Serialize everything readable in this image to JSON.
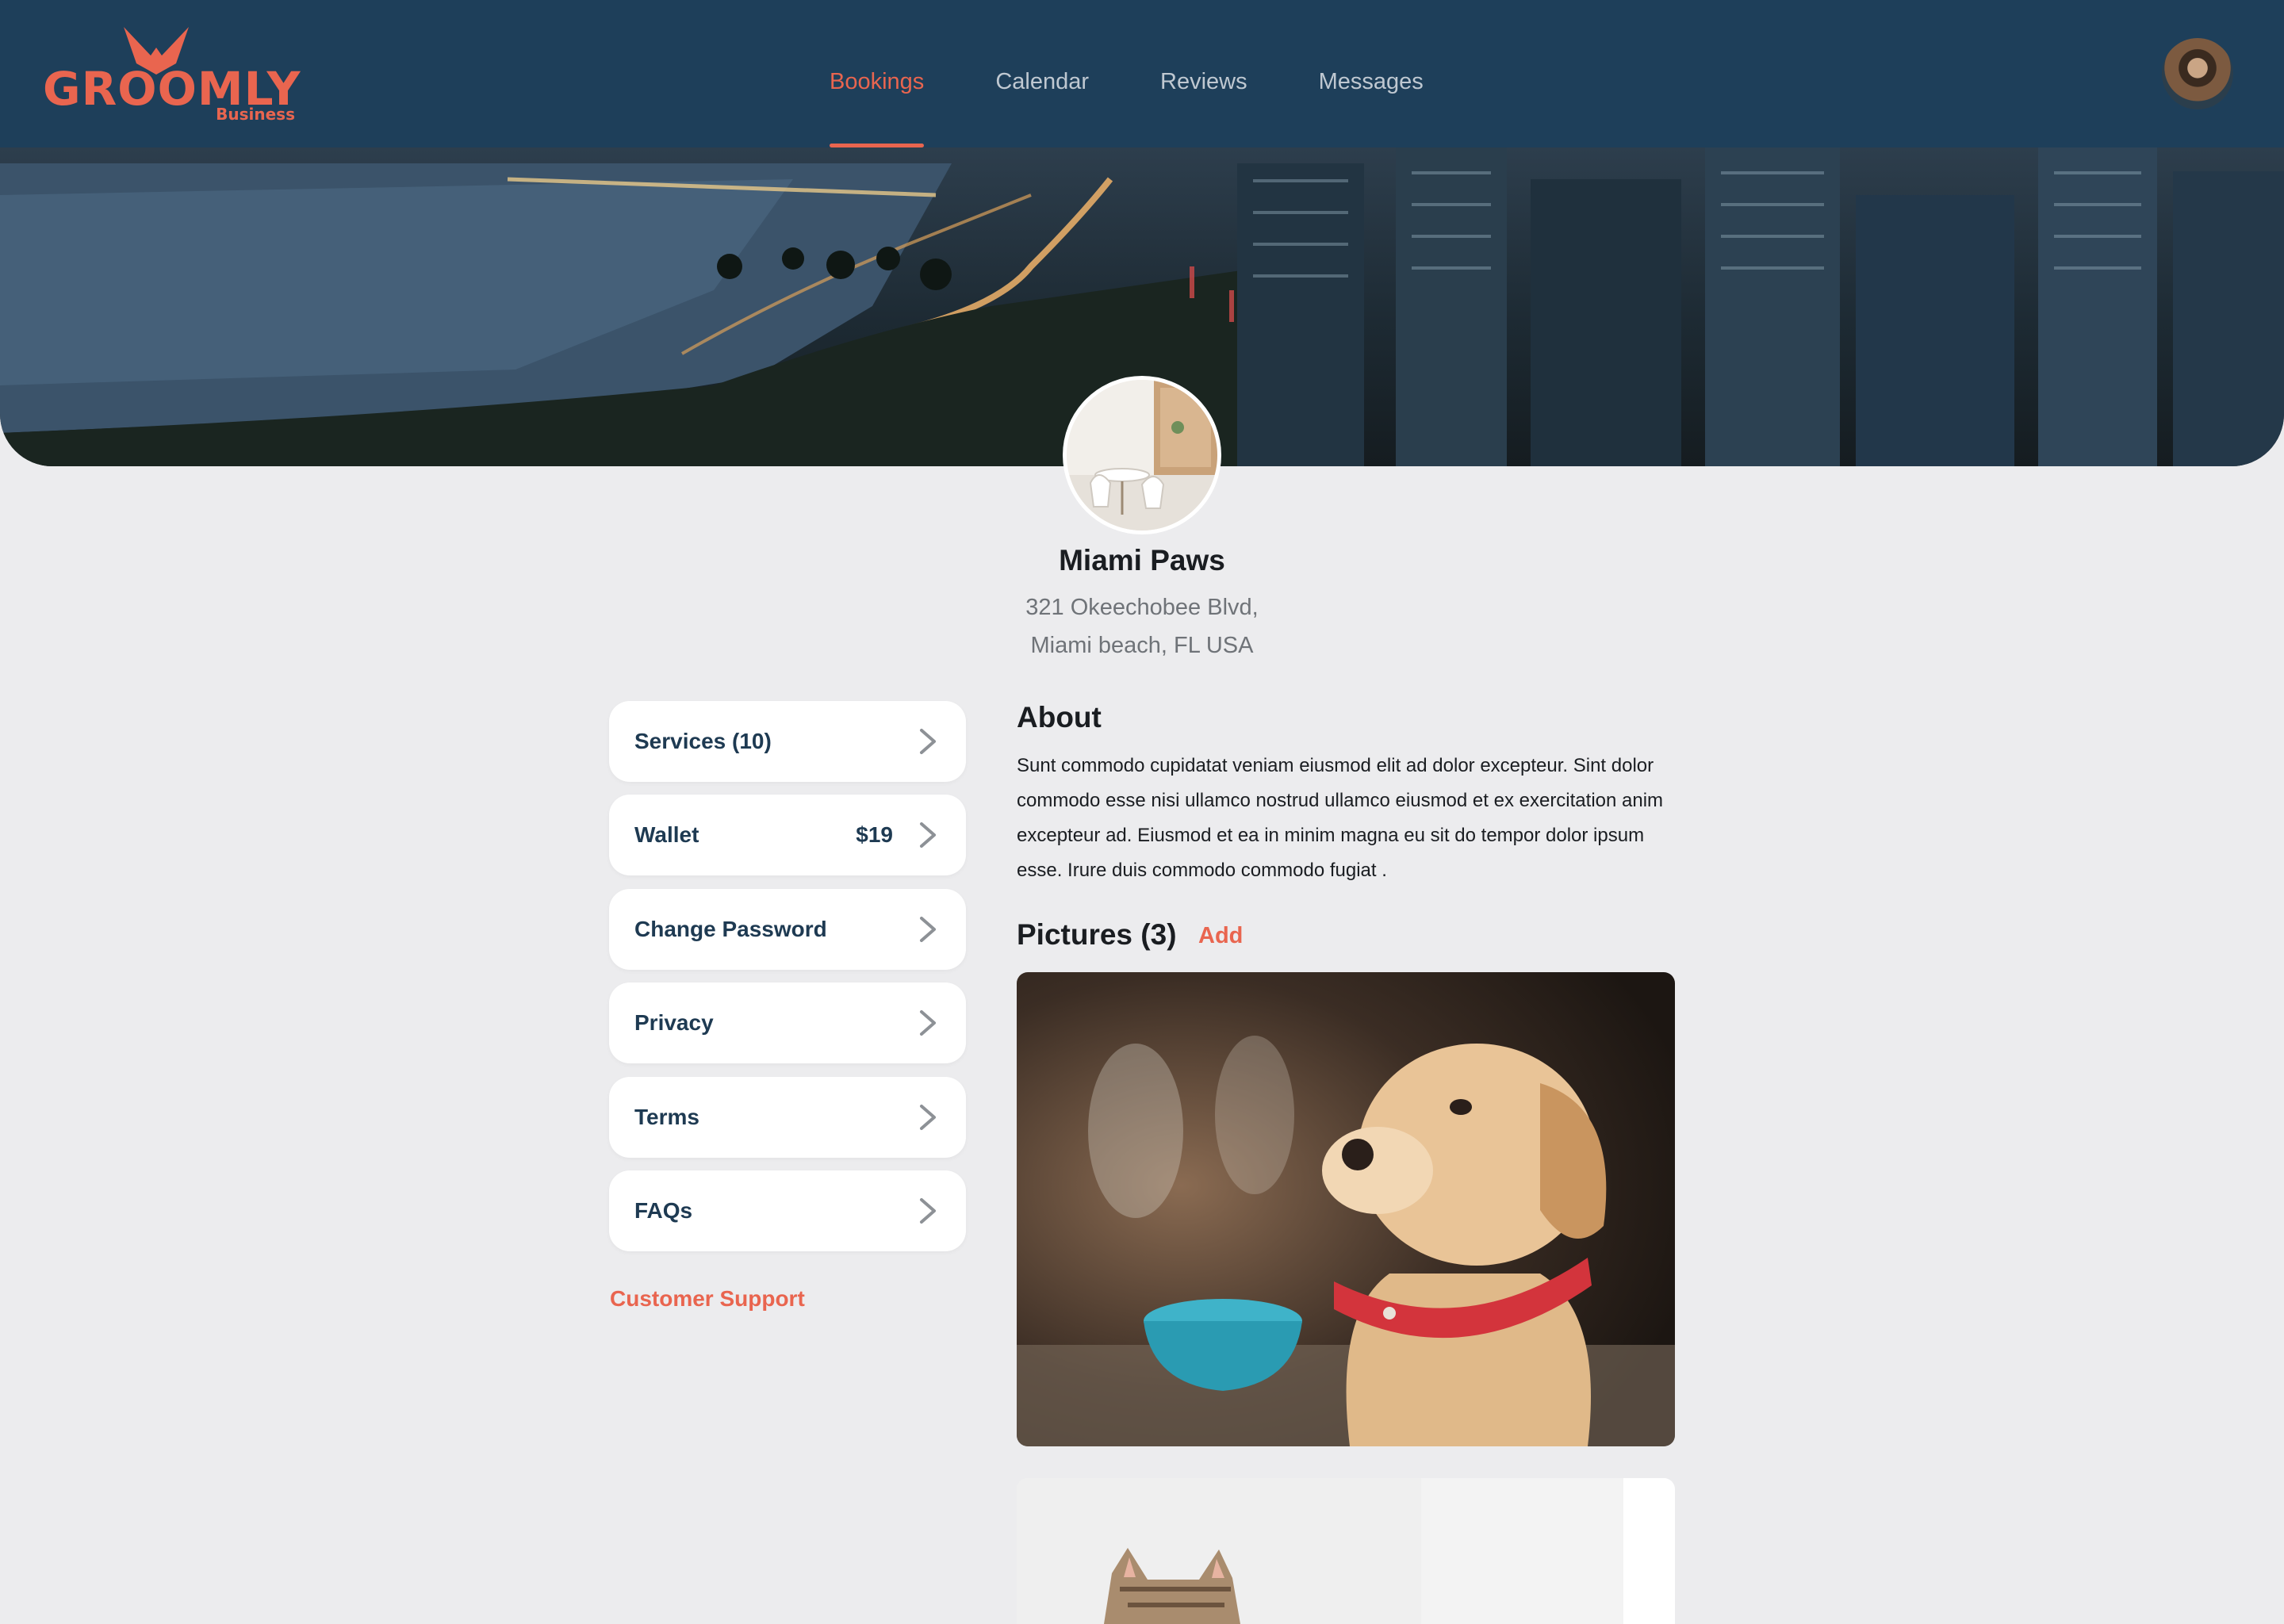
{
  "brand": {
    "name": "GROOMLY",
    "sub": "Business",
    "color": "#e9654f",
    "header_bg": "#1e3f5a"
  },
  "nav": {
    "items": [
      {
        "label": "Bookings",
        "active": true
      },
      {
        "label": "Calendar",
        "active": false
      },
      {
        "label": "Reviews",
        "active": false
      },
      {
        "label": "Messages",
        "active": false
      }
    ]
  },
  "user": {
    "avatar_icon": "user-avatar"
  },
  "business": {
    "name": "Miami Paws",
    "address_line1": "321 Okeechobee Blvd,",
    "address_line2": "Miami beach, FL USA"
  },
  "menu": {
    "items": [
      {
        "label": "Services (10)",
        "value": ""
      },
      {
        "label": "Wallet",
        "value": "$19"
      },
      {
        "label": "Change Password",
        "value": ""
      },
      {
        "label": "Privacy",
        "value": ""
      },
      {
        "label": "Terms",
        "value": ""
      },
      {
        "label": "FAQs",
        "value": ""
      }
    ],
    "chevron_icon": "chevron-right-icon",
    "support_label": "Customer Support"
  },
  "about": {
    "title": "About",
    "text": "Sunt commodo cupidatat veniam eiusmod elit ad dolor excepteur. Sint dolor commodo esse nisi ullamco nostrud ullamco eiusmod et ex exercitation anim excepteur ad. Eiusmod et ea in minim magna eu sit do tempor dolor ipsum esse. Irure duis commodo commodo fugiat ."
  },
  "pictures": {
    "title": "Pictures (3)",
    "add_label": "Add",
    "items": [
      {
        "subject": "puppy"
      },
      {
        "subject": "cat"
      }
    ]
  }
}
